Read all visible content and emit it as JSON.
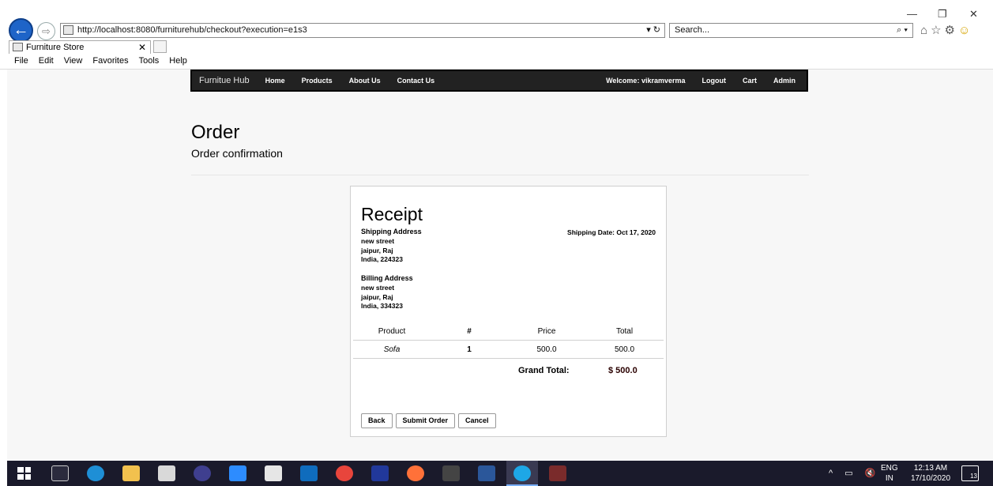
{
  "browser": {
    "url": "http://localhost:8080/furniturehub/checkout?execution=e1s3",
    "search_placeholder": "Search...",
    "search_tools": "⌕ ▾",
    "address_tools": "▾ ↻",
    "tab_title": "Furniture Store",
    "menu": [
      "File",
      "Edit",
      "View",
      "Favorites",
      "Tools",
      "Help"
    ],
    "window_controls": {
      "minimize": "—",
      "restore": "❐",
      "close": "✕"
    },
    "icons": [
      "home-icon",
      "star-icon",
      "gear-icon",
      "smiley-icon"
    ]
  },
  "navbar": {
    "brand": "Furnitue Hub",
    "links": [
      "Home",
      "Products",
      "About Us",
      "Contact Us"
    ],
    "right": [
      "Welcome: vikramverma",
      "Logout",
      "Cart",
      "Admin"
    ]
  },
  "page": {
    "title": "Order",
    "subtitle": "Order confirmation"
  },
  "receipt": {
    "title": "Receipt",
    "shipping_date": "Shipping Date: Oct 17, 2020",
    "shipping": {
      "label": "Shipping Address",
      "line1": "new street",
      "line2": "jaipur, Raj",
      "line3": "India, 224323"
    },
    "billing": {
      "label": "Billing Address",
      "line1": "new street",
      "line2": "jaipur, Raj",
      "line3": "India, 334323"
    },
    "table": {
      "headers": [
        "Product",
        "#",
        "Price",
        "Total"
      ],
      "rows": [
        [
          "Sofa",
          "1",
          "500.0",
          "500.0"
        ]
      ]
    },
    "grand_total_label": "Grand Total:",
    "grand_total_value": "$ 500.0",
    "buttons": {
      "back": "Back",
      "submit": "Submit Order",
      "cancel": "Cancel"
    }
  },
  "taskbar": {
    "language": "ENG",
    "region": "IN",
    "time": "12:13 AM",
    "date": "17/10/2020",
    "notifications": "13"
  }
}
